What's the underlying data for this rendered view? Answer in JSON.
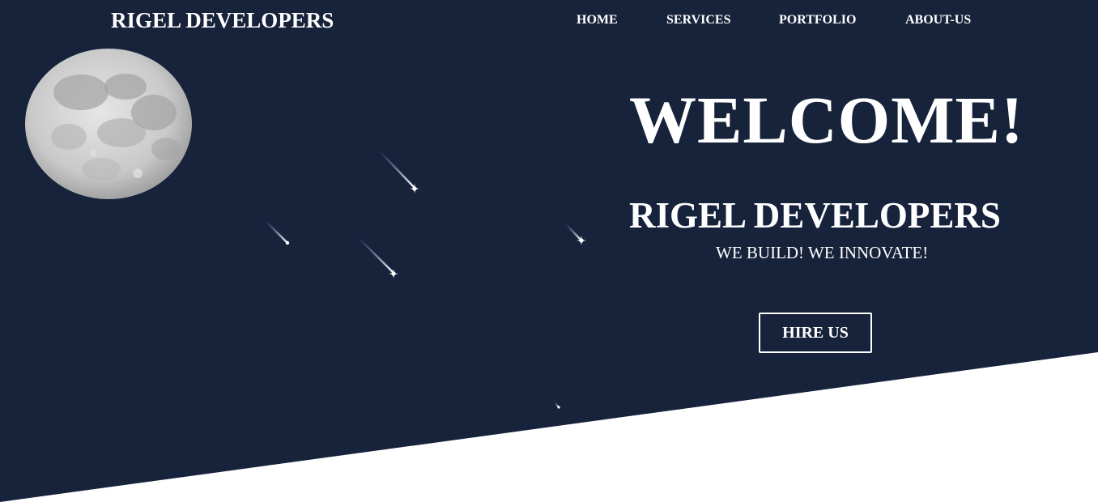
{
  "header": {
    "brand": "RIGEL DEVELOPERS",
    "nav": [
      {
        "label": "HOME"
      },
      {
        "label": "SERVICES"
      },
      {
        "label": "PORTFOLIO"
      },
      {
        "label": "ABOUT-US"
      }
    ]
  },
  "hero": {
    "headline": "WELCOME!",
    "company": "RIGEL DEVELOPERS",
    "tagline": "WE BUILD! WE INNOVATE!",
    "cta_label": "HIRE US",
    "icons": [
      "moon-icon",
      "shooting-star-icon"
    ]
  },
  "colors": {
    "background": "#17223b",
    "text": "#ffffff",
    "lower_background": "#ffffff"
  }
}
